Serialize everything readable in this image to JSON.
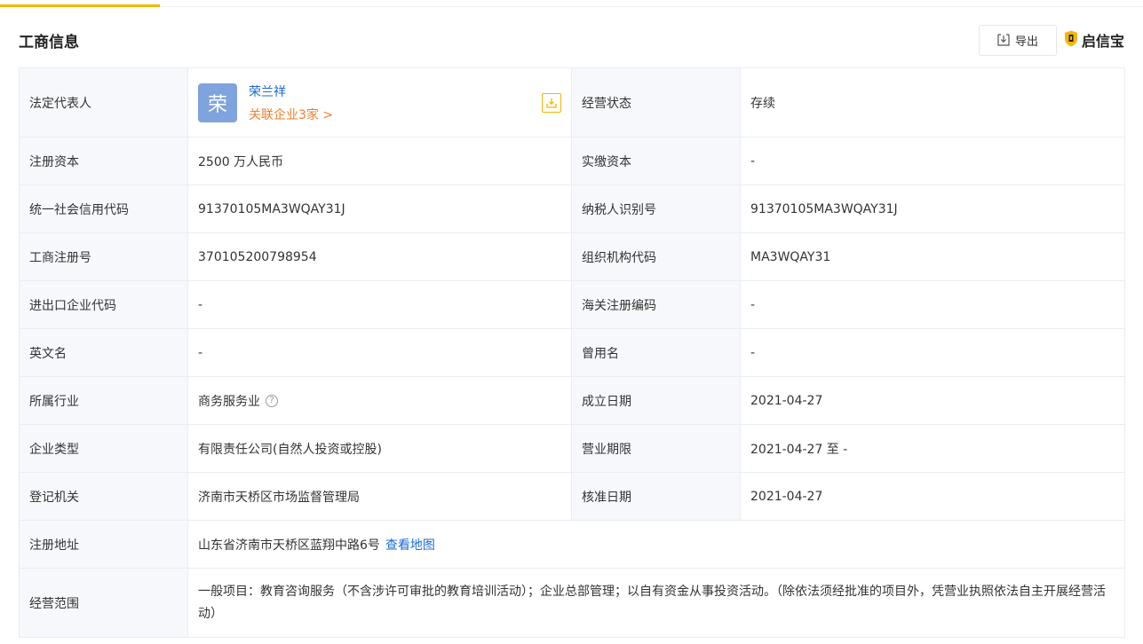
{
  "header": {
    "title": "工商信息",
    "export_label": "导出",
    "brand": "启信宝"
  },
  "rep": {
    "label": "法定代表人",
    "avatar_char": "荣",
    "name": "荣兰祥",
    "related": "关联企业3家 >"
  },
  "rows": [
    {
      "l1": "经营状态",
      "v1": "存续"
    },
    {
      "l1": "注册资本",
      "v1": "2500 万人民币",
      "l2": "实缴资本",
      "v2": "-"
    },
    {
      "l1": "统一社会信用代码",
      "v1": "91370105MA3WQAY31J",
      "l2": "纳税人识别号",
      "v2": "91370105MA3WQAY31J"
    },
    {
      "l1": "工商注册号",
      "v1": "370105200798954",
      "l2": "组织机构代码",
      "v2": "MA3WQAY31"
    },
    {
      "l1": "进出口企业代码",
      "v1": "-",
      "l2": "海关注册编码",
      "v2": "-"
    },
    {
      "l1": "英文名",
      "v1": "-",
      "l2": "曾用名",
      "v2": "-"
    },
    {
      "l1": "所属行业",
      "v1": "商务服务业",
      "l2": "成立日期",
      "v2": "2021-04-27"
    },
    {
      "l1": "企业类型",
      "v1": "有限责任公司(自然人投资或控股)",
      "l2": "营业期限",
      "v2": "2021-04-27 至 -"
    },
    {
      "l1": "登记机关",
      "v1": "济南市天桥区市场监督管理局",
      "l2": "核准日期",
      "v2": "2021-04-27"
    }
  ],
  "address": {
    "label": "注册地址",
    "value": "山东省济南市天桥区蓝翔中路6号",
    "map_link": "查看地图"
  },
  "scope": {
    "label": "经营范围",
    "value": "一般项目：教育咨询服务（不含涉许可审批的教育培训活动）；企业总部管理；以自有资金从事投资活动。（除依法须经批准的项目外，凭营业执照依法自主开展经营活动）"
  },
  "colors": {
    "accent": "#f5b700",
    "link": "#1b6ad8",
    "related": "#f07f2a",
    "label_bg": "#f6f8fb",
    "avatar_bg": "#7fa3dc"
  },
  "icons": {
    "export": "download-icon",
    "brand": "shield-logo-icon",
    "rep_download": "download-icon",
    "industry_help": "question-circle-icon"
  }
}
